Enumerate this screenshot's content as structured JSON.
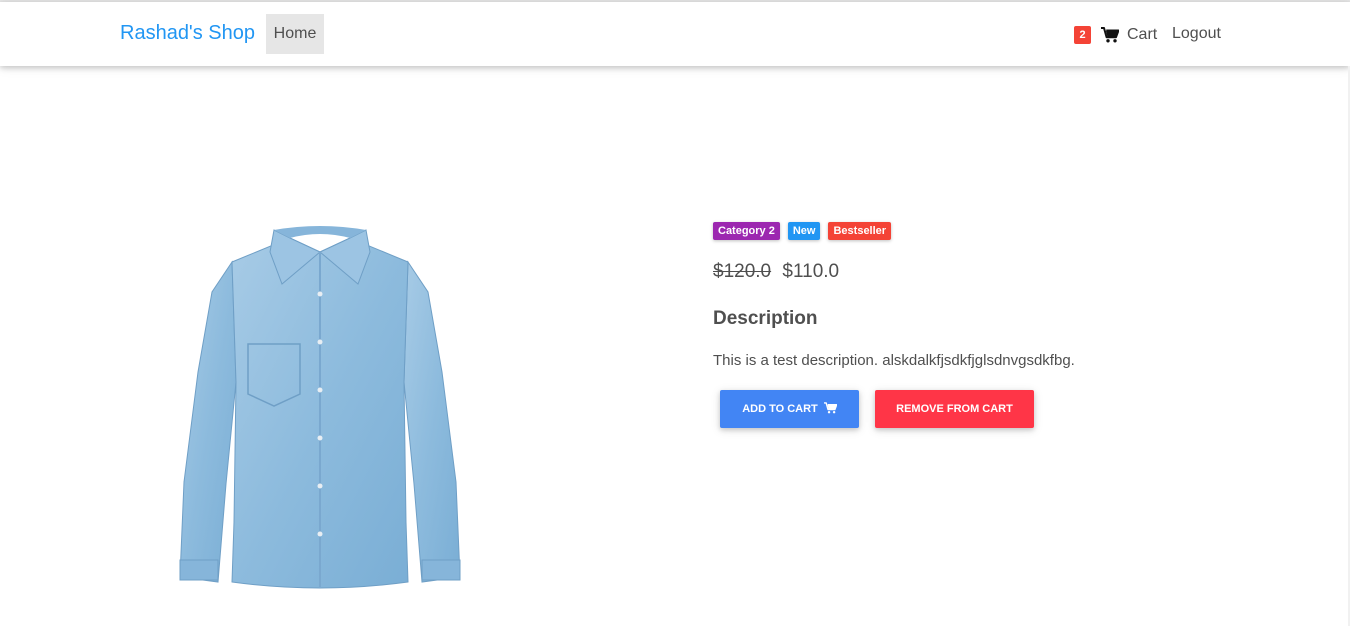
{
  "colors": {
    "brand": "#2196f3",
    "nav_active_bg": "#e6e6e6",
    "cart_badge": "#f44336",
    "badge_category": "#9c27b0",
    "badge_new": "#2196f3",
    "badge_bestseller": "#f44336",
    "add_button": "#4285f4",
    "remove_button": "#ff3547",
    "shirt": "#8fbcdf"
  },
  "navbar": {
    "brand": "Rashad's Shop",
    "home_label": "Home",
    "cart_count": "2",
    "cart_icon": "shopping-cart-icon",
    "cart_label": "Cart",
    "logout_label": "Logout"
  },
  "product": {
    "image_alt": "denim-shirt",
    "badges": [
      {
        "label": "Category 2",
        "color": "#9c27b0"
      },
      {
        "label": "New",
        "color": "#2196f3"
      },
      {
        "label": "Bestseller",
        "color": "#f44336"
      }
    ],
    "old_price": "$120.0",
    "price": "$110.0",
    "description_heading": "Description",
    "description": "This is a test description. alskdalkfjsdkfjglsdnvgsdkfbg.",
    "add_to_cart_label": "ADD TO CART",
    "add_to_cart_icon": "shopping-cart-icon",
    "remove_from_cart_label": "REMOVE FROM CART"
  }
}
